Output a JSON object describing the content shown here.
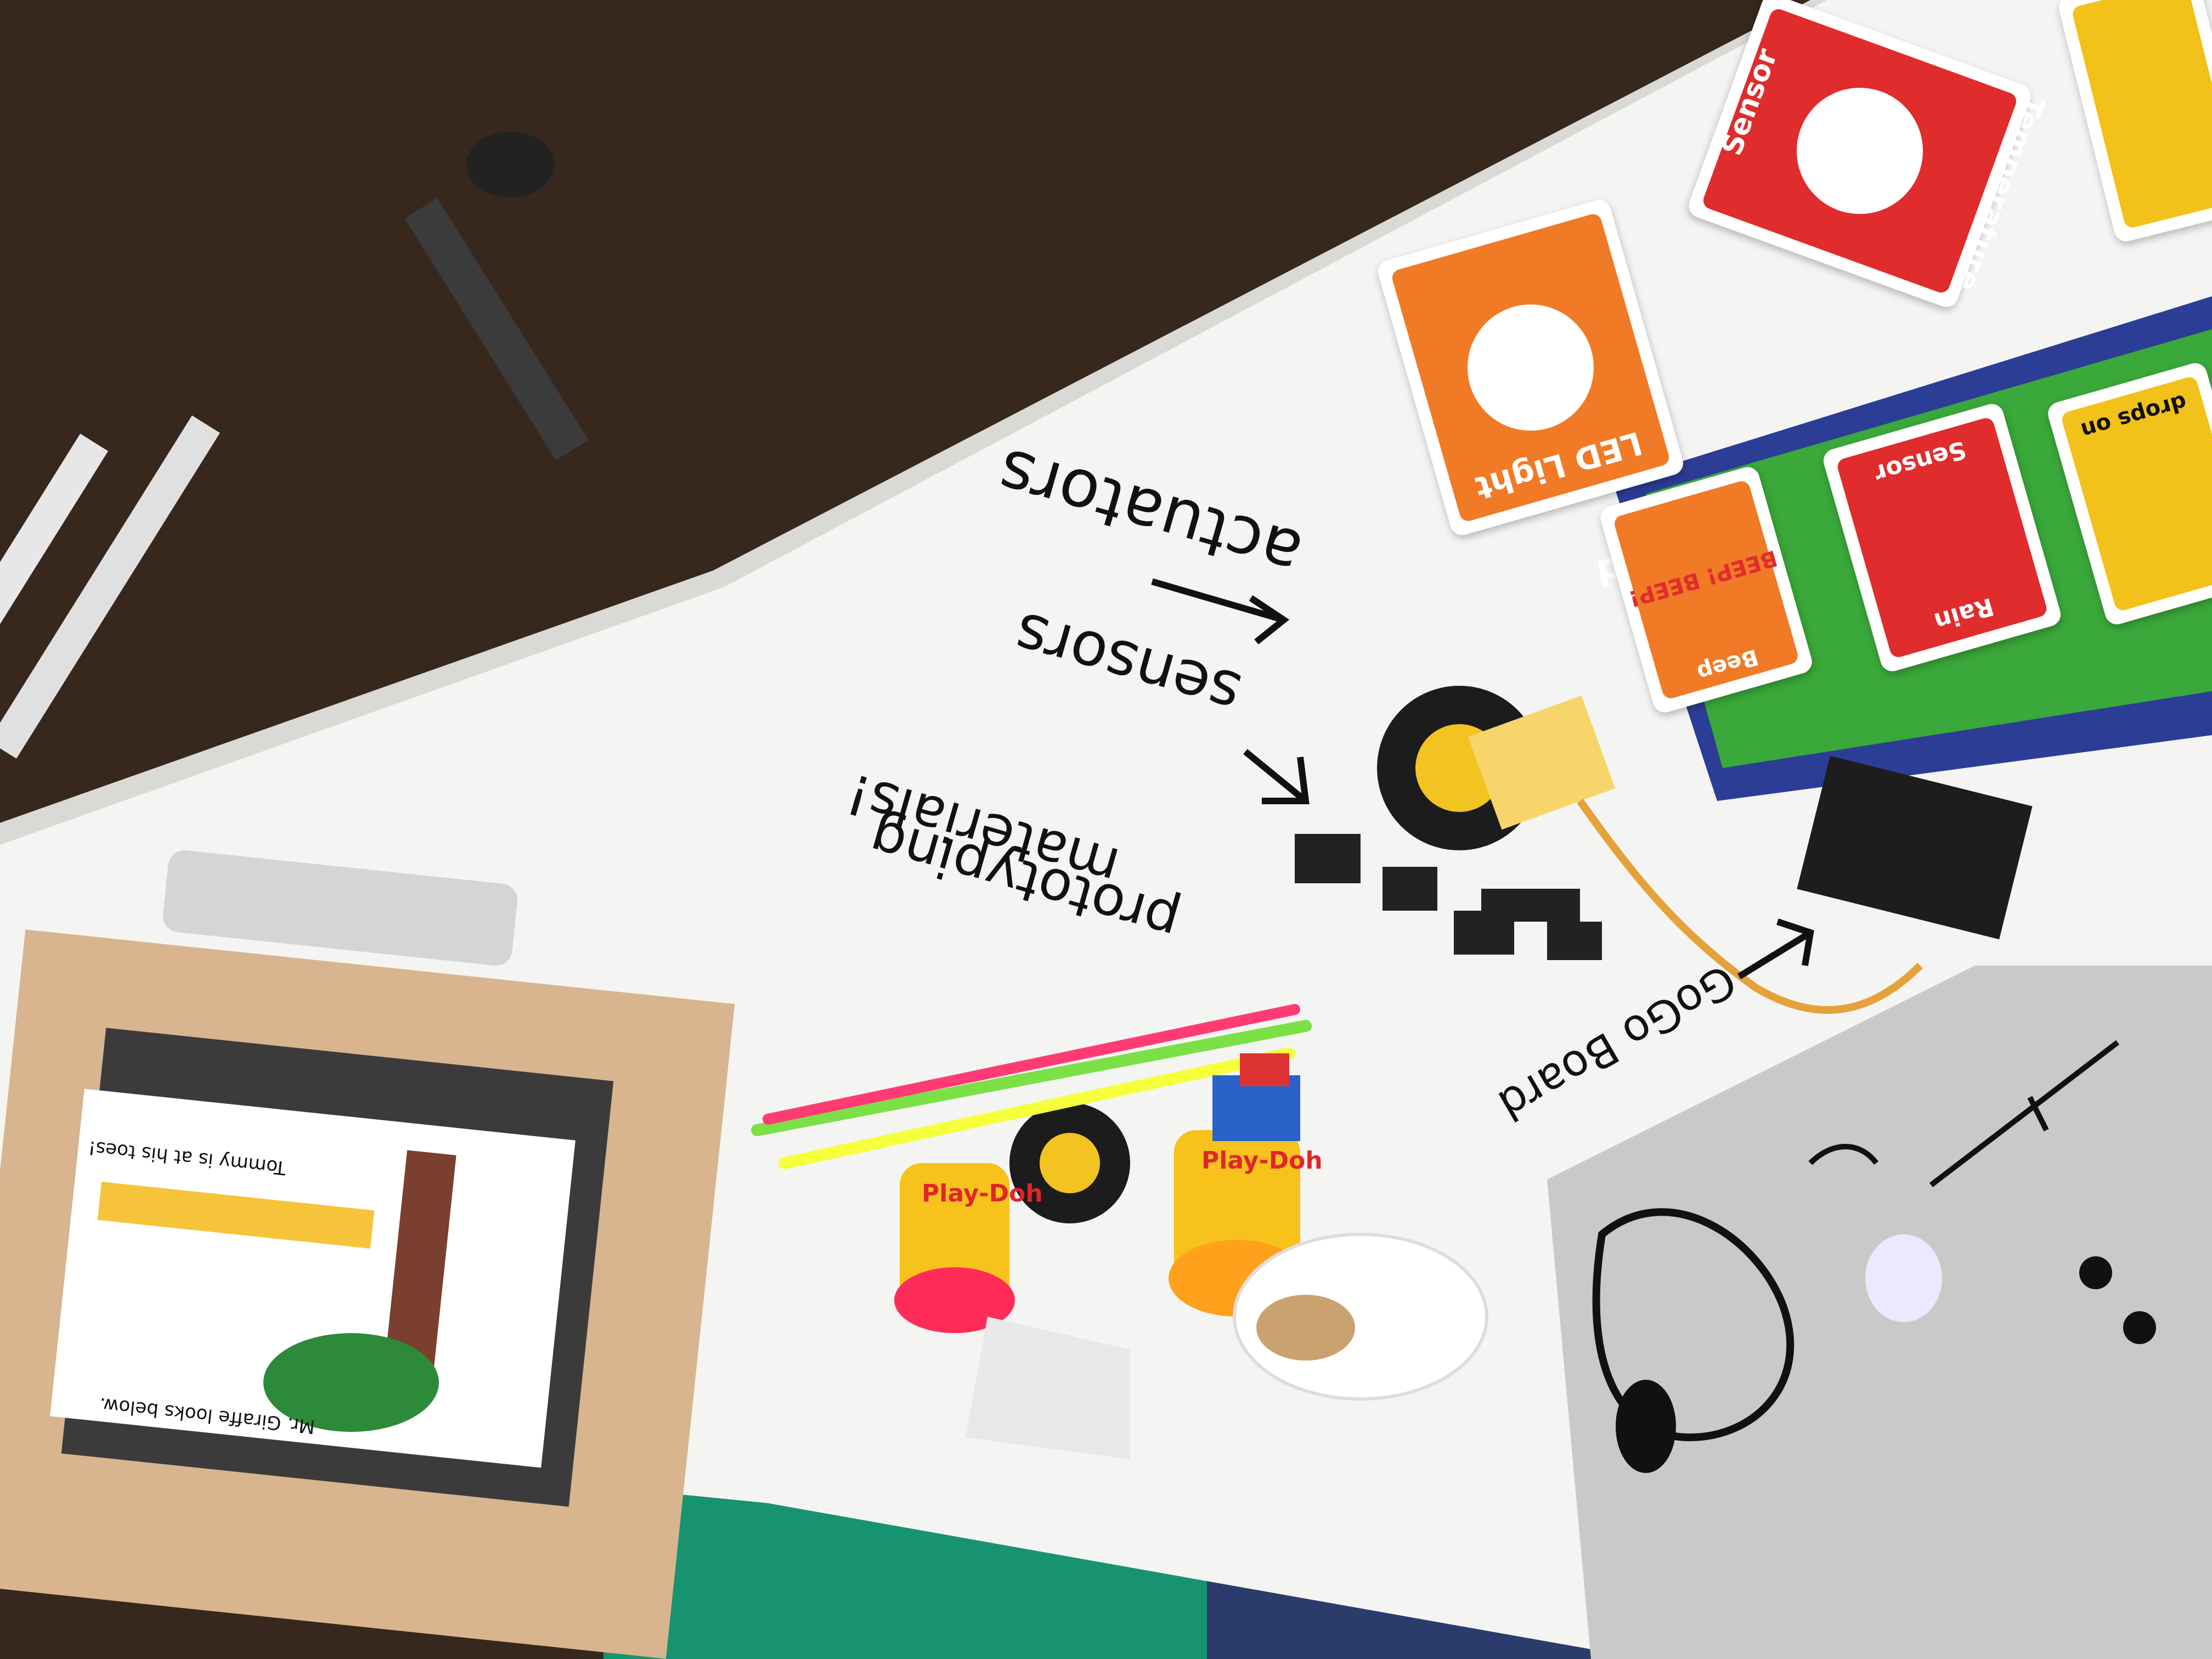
{
  "handwriting": {
    "actuators": "actuators",
    "sensors": "sensors",
    "prototyping_line1": "prototyping",
    "prototyping_line2": "materials!",
    "gogo_board": "GoGo Board"
  },
  "cards": {
    "led_light": "LED Light",
    "temperature": "Temperature",
    "sensor_1": "Sensor",
    "sensor_2": "Sensor",
    "rain": "Rain",
    "beep": "Beep",
    "beep_sound": "BEEP! BEEP!",
    "drops": "drops on"
  },
  "board_strip": {
    "end_label": "end"
  },
  "book": {
    "caption_top": "Tommy is at his toes!",
    "caption_bottom": "Mr. Giraffe looks below."
  },
  "jars": {
    "brand": "Play-Doh"
  },
  "colors": {
    "floor": "#3a2a1f",
    "table": "#f3f3f1",
    "card_orange": "#f07a26",
    "card_red": "#e02c2c",
    "card_yellow": "#f2c21b",
    "mat_blue": "#2b3a93",
    "mat_green": "#3aa63a",
    "carpet": "#1a9a6e",
    "laptop": "#c9c9c9"
  }
}
